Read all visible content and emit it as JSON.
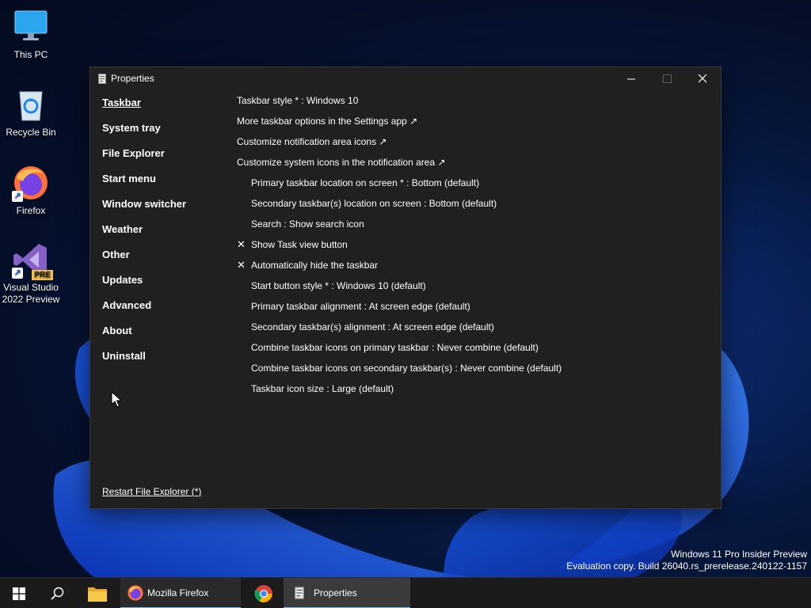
{
  "desktop": {
    "icons": [
      {
        "label": "This PC",
        "icon": "monitor-icon"
      },
      {
        "label": "Recycle Bin",
        "icon": "recycle-bin-icon"
      },
      {
        "label": "Firefox",
        "icon": "firefox-icon"
      },
      {
        "label": "Visual Studio 2022 Preview",
        "icon": "visual-studio-icon",
        "badge": "PRE"
      }
    ]
  },
  "window": {
    "title": "Properties",
    "nav": [
      {
        "label": "Taskbar",
        "active": true
      },
      {
        "label": "System tray"
      },
      {
        "label": "File Explorer"
      },
      {
        "label": "Start menu"
      },
      {
        "label": "Window switcher"
      },
      {
        "label": "Weather"
      },
      {
        "label": "Other"
      },
      {
        "label": "Updates"
      },
      {
        "label": "Advanced"
      },
      {
        "label": "About"
      },
      {
        "label": "Uninstall"
      }
    ],
    "restart_link": "Restart File Explorer (*)",
    "settings": [
      {
        "label": "Taskbar style * : Windows 10"
      },
      {
        "label": "More taskbar options in the Settings app ↗"
      },
      {
        "label": "Customize notification area icons ↗"
      },
      {
        "label": "Customize system icons in the notification area ↗"
      },
      {
        "label": "Primary taskbar location on screen * : Bottom (default)"
      },
      {
        "label": "Secondary taskbar(s) location on screen : Bottom (default)"
      },
      {
        "label": "Search : Show search icon"
      },
      {
        "label": "Show Task view button",
        "checked": true
      },
      {
        "label": "Automatically hide the taskbar",
        "checked": true
      },
      {
        "label": "Start button style * : Windows 10 (default)"
      },
      {
        "label": "Primary taskbar alignment : At screen edge (default)"
      },
      {
        "label": "Secondary taskbar(s) alignment : At screen edge (default)"
      },
      {
        "label": "Combine taskbar icons on primary taskbar : Never combine (default)"
      },
      {
        "label": "Combine taskbar icons on secondary taskbar(s) : Never combine (default)"
      },
      {
        "label": "Taskbar icon size : Large (default)"
      }
    ],
    "check_glyph": "✕"
  },
  "watermark": {
    "line1": "Windows 11 Pro Insider Preview",
    "line2": "Evaluation copy. Build 26040.rs_prerelease.240122-1157"
  },
  "taskbar": {
    "firefox_label": "Mozilla Firefox",
    "properties_label": "Properties",
    "accent": "#76b9ed"
  }
}
